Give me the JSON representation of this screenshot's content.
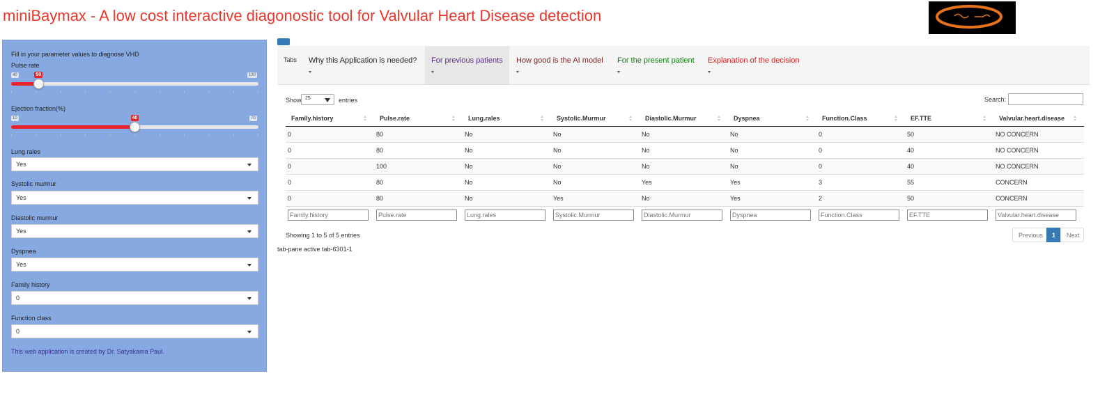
{
  "app": {
    "title": "miniBaymax - A low cost interactive diagonostic tool for Valvular Heart Disease detection"
  },
  "sidebar": {
    "intro": "Fill in your parameter values to diagnose VHD",
    "pulse_rate": {
      "label": "Pulse rate",
      "min": "40",
      "max": "130",
      "value": "50",
      "fraction": 0.111
    },
    "ejection_fraction": {
      "label": "Ejection fraction(%)",
      "min": "10",
      "max": "70",
      "value": "40",
      "fraction": 0.5
    },
    "selects": [
      {
        "label": "Lung rales",
        "value": "Yes"
      },
      {
        "label": "Systolic murmur",
        "value": "Yes"
      },
      {
        "label": "Diastolic murmur",
        "value": "Yes"
      },
      {
        "label": "Dyspnea",
        "value": "Yes"
      },
      {
        "label": "Family history",
        "value": "0"
      },
      {
        "label": "Function class",
        "value": "0"
      }
    ],
    "credit": "This web application is created by Dr. Satyakama Paul."
  },
  "tabs": {
    "label": "Tabs",
    "items": [
      {
        "label": "Why this Application is needed?",
        "color": "#222222"
      },
      {
        "label": "For previous patients",
        "color": "#5b2a86"
      },
      {
        "label": "How good is the AI model",
        "color": "#7a1f1f"
      },
      {
        "label": "For the present patient",
        "color": "#0f7a0f"
      },
      {
        "label": "Explanation of the decision",
        "color": "#d42020"
      }
    ],
    "active_index": 1
  },
  "table": {
    "show_label": "Show",
    "length_value": "25",
    "entries_label": "entries",
    "search_label": "Search:",
    "columns": [
      "Family.history",
      "Pulse.rate",
      "Lung.rales",
      "Systolic.Murmur",
      "Diastolic.Murmur",
      "Dyspnea",
      "Function.Class",
      "EF.TTE",
      "Valvular.heart.disease"
    ],
    "rows": [
      [
        "0",
        "80",
        "No",
        "No",
        "No",
        "No",
        "0",
        "50",
        "NO CONCERN"
      ],
      [
        "0",
        "80",
        "No",
        "No",
        "No",
        "No",
        "0",
        "40",
        "NO CONCERN"
      ],
      [
        "0",
        "100",
        "No",
        "No",
        "No",
        "No",
        "0",
        "40",
        "NO CONCERN"
      ],
      [
        "0",
        "80",
        "No",
        "No",
        "Yes",
        "Yes",
        "3",
        "55",
        "CONCERN"
      ],
      [
        "0",
        "80",
        "No",
        "Yes",
        "No",
        "Yes",
        "2",
        "50",
        "CONCERN"
      ]
    ],
    "info": "Showing 1 to 5 of 5 entries",
    "pager": {
      "previous": "Previous",
      "current": "1",
      "next": "Next"
    }
  },
  "pane_text": "tab-pane active tab-6301-1"
}
